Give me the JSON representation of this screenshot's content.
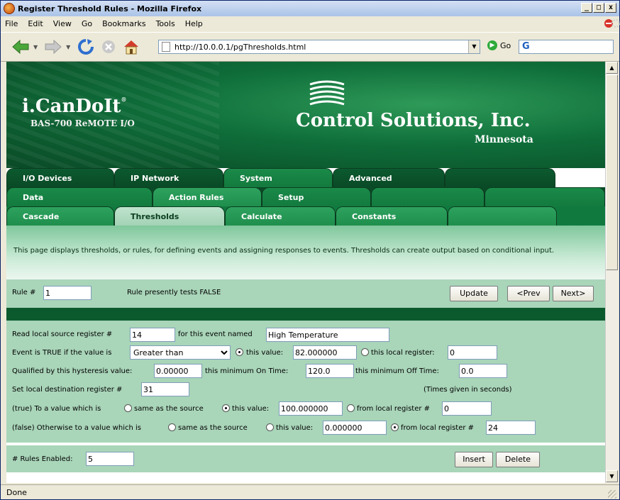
{
  "window": {
    "title": "Register Threshold Rules - Mozilla Firefox",
    "min": "_",
    "max": "□",
    "close": "x"
  },
  "menu": [
    "File",
    "Edit",
    "View",
    "Go",
    "Bookmarks",
    "Tools",
    "Help"
  ],
  "address": {
    "url": "http://10.0.0.1/pgThresholds.html",
    "go_label": "Go",
    "search_glyph": "G"
  },
  "status": "Done",
  "banner": {
    "brand": "i.CanDoIt",
    "brand_mark": "®",
    "brand_sub": "BAS-700 ReMOTE I/O",
    "company": "Control Solutions, Inc.",
    "company_state": "Minnesota"
  },
  "tabs": {
    "row1": [
      "I/O Devices",
      "IP Network",
      "System",
      "Advanced",
      ""
    ],
    "row2": [
      "Data",
      "Action Rules",
      "Setup",
      "",
      ""
    ],
    "row3": [
      "Cascade",
      "Thresholds",
      "Calculate",
      "Constants",
      ""
    ],
    "active": {
      "row1": "System",
      "row2": "Action Rules",
      "row3": "Thresholds"
    }
  },
  "description": "This page displays thresholds, or rules, for defining events and assigning responses to events. Thresholds can create output based on conditional input.",
  "rule": {
    "label": "Rule #",
    "value": "1",
    "status": "Rule presently tests FALSE",
    "update": "Update",
    "prev": "<Prev",
    "next": "Next>"
  },
  "form": {
    "read_label": "Read local source register #",
    "read_value": "14",
    "event_label": "for this event named",
    "event_value": "High Temperature",
    "true_if_label": "Event is TRUE if the value is",
    "comparison": "Greater than",
    "this_value_label": "this value:",
    "this_value": "82.000000",
    "this_local_label": "this local register:",
    "this_local_value": "0",
    "hyst_label": "Qualified by this hysteresis value:",
    "hyst_value": "0.00000",
    "min_on_label": "this minimum On Time:",
    "min_on_value": "120.0",
    "min_off_label": "this minimum Off Time:",
    "min_off_value": "0.0",
    "dest_label": "Set local destination register #",
    "dest_value": "31",
    "times_note": "(Times given in seconds)",
    "true_label": "(true) To a value which is",
    "same_source": "same as the source",
    "true_this_value": "100.000000",
    "from_local": "from local register #",
    "true_from_local": "0",
    "false_label": "(false) Otherwise to a value which is",
    "false_this_value": "0.000000",
    "false_from_local": "24"
  },
  "bottom": {
    "enabled_label": "# Rules Enabled:",
    "enabled_value": "5",
    "insert": "Insert",
    "delete": "Delete"
  }
}
